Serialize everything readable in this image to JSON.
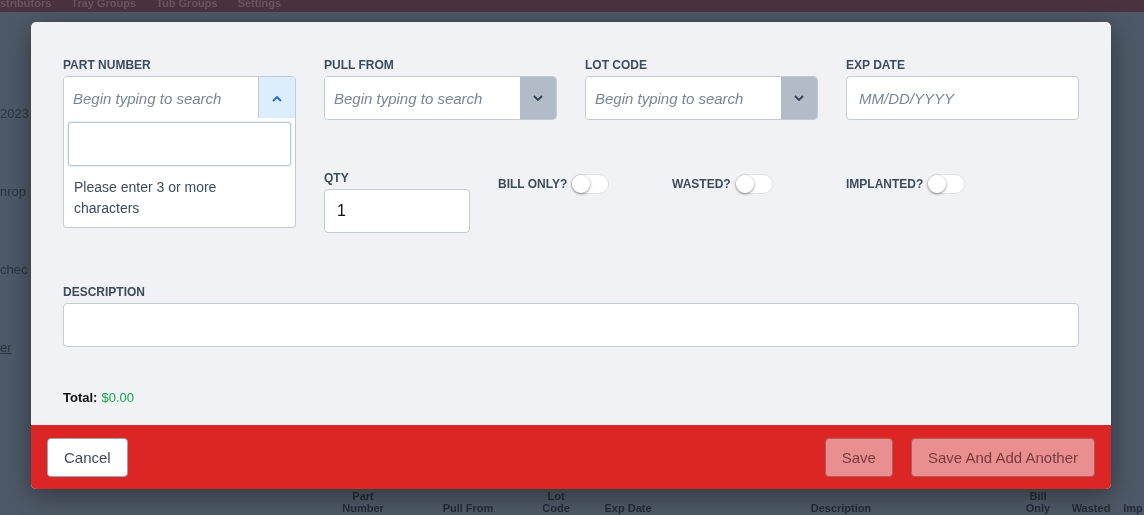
{
  "nav": [
    "stributors",
    "Tray Groups",
    "Tub Groups",
    "Settings"
  ],
  "background_fragments": [
    {
      "text": "2023",
      "kind": "text"
    },
    {
      "text": "nrop",
      "kind": "text"
    },
    {
      "text": "chec",
      "kind": "text"
    },
    {
      "text": "er",
      "kind": "link"
    }
  ],
  "background_table_columns": [
    "Part Number",
    "Pull From",
    "Lot Code",
    "Exp Date",
    "Description",
    "Bill Only",
    "Wasted",
    "Imp"
  ],
  "modal": {
    "fields": [
      {
        "label": "PART NUMBER",
        "placeholder": "Begin typing to search",
        "kind": "select",
        "expanded": true
      },
      {
        "label": "PULL FROM",
        "placeholder": "Begin typing to search",
        "kind": "select",
        "expanded": false
      },
      {
        "label": "LOT CODE",
        "placeholder": "Begin typing to search",
        "kind": "select",
        "expanded": false
      },
      {
        "label": "EXP DATE",
        "placeholder": "MM/DD/YYYY",
        "kind": "date"
      }
    ],
    "dropdown": {
      "message": "Please enter 3 or more characters"
    },
    "qty": {
      "label": "QTY",
      "value": "1"
    },
    "toggles": [
      {
        "label": "BILL ONLY?",
        "on": false
      },
      {
        "label": "WASTED?",
        "on": false
      },
      {
        "label": "IMPLANTED?",
        "on": false
      }
    ],
    "description": {
      "label": "DESCRIPTION"
    },
    "total": {
      "label": "Total:",
      "value": "$0.00"
    },
    "buttons": [
      {
        "label": "Cancel",
        "kind": "secondary",
        "disabled": false
      },
      {
        "label": "Save",
        "kind": "primary",
        "disabled": true
      },
      {
        "label": "Save And Add Another",
        "kind": "primary",
        "disabled": true
      }
    ]
  }
}
